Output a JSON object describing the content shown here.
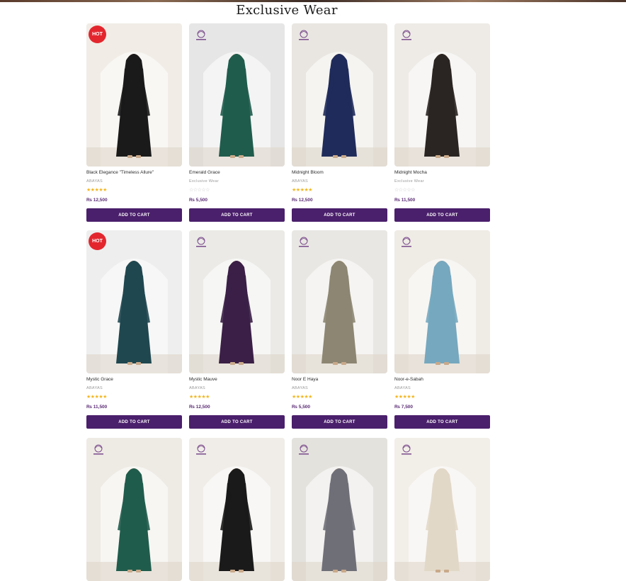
{
  "section": {
    "title": "Exclusive Wear"
  },
  "colors": {
    "brand_purple": "#4a1f6b",
    "hot_badge": "#e3262e",
    "star": "#f3b61f"
  },
  "products": [
    {
      "name": "Black Elegance \"Timeless Allure\"",
      "category": "ABAYAS",
      "rating": 5,
      "price": "₨ 12,500",
      "button": "ADD TO CART",
      "badge": "HOT",
      "dress": "#1a1a1a",
      "bg": "#f1ede6"
    },
    {
      "name": "Emerald Grace",
      "category": "Exclusive Wear",
      "rating": 0,
      "price": "₨ 5,500",
      "button": "ADD TO CART",
      "badge": "",
      "dress": "#1f5c4c",
      "bg": "#e6e6e6"
    },
    {
      "name": "Midnight Bloom",
      "category": "ABAYAS",
      "rating": 5,
      "price": "₨ 12,500",
      "button": "ADD TO CART",
      "badge": "",
      "dress": "#1f2b5a",
      "bg": "#e9e6e1"
    },
    {
      "name": "Midnight Mocha",
      "category": "Exclusive Wear",
      "rating": 0,
      "price": "₨ 11,500",
      "button": "ADD TO CART",
      "badge": "",
      "dress": "#2a2522",
      "bg": "#eeebe6"
    },
    {
      "name": "Mystic Grace",
      "category": "ABAYAS",
      "rating": 5,
      "price": "₨ 11,500",
      "button": "ADD TO CART",
      "badge": "HOT",
      "dress": "#1f4750",
      "bg": "#eeeeee"
    },
    {
      "name": "Mystic Mauve",
      "category": "ABAYAS",
      "rating": 5,
      "price": "₨ 12,500",
      "button": "ADD TO CART",
      "badge": "",
      "dress": "#3b1f47",
      "bg": "#ebeae7"
    },
    {
      "name": "Noor E Haya",
      "category": "ABAYAS",
      "rating": 5,
      "price": "₨ 5,500",
      "button": "ADD TO CART",
      "badge": "",
      "dress": "#8c8672",
      "bg": "#e9e7e3"
    },
    {
      "name": "Noor-e-Sabah",
      "category": "ABAYAS",
      "rating": 5,
      "price": "₨ 7,500",
      "button": "ADD TO CART",
      "badge": "",
      "dress": "#76a8bf",
      "bg": "#efebe5"
    },
    {
      "name": "",
      "category": "",
      "rating": 0,
      "price": "",
      "button": "",
      "badge": "",
      "dress": "#1f5c4c",
      "bg": "#eeeae4"
    },
    {
      "name": "",
      "category": "",
      "rating": 0,
      "price": "",
      "button": "",
      "badge": "",
      "dress": "#1a1a1a",
      "bg": "#f0ede8"
    },
    {
      "name": "",
      "category": "",
      "rating": 0,
      "price": "",
      "button": "",
      "badge": "",
      "dress": "#6f6f78",
      "bg": "#e4e2dd"
    },
    {
      "name": "",
      "category": "",
      "rating": 0,
      "price": "",
      "button": "",
      "badge": "",
      "dress": "#e2d8c8",
      "bg": "#f2eee8"
    }
  ]
}
